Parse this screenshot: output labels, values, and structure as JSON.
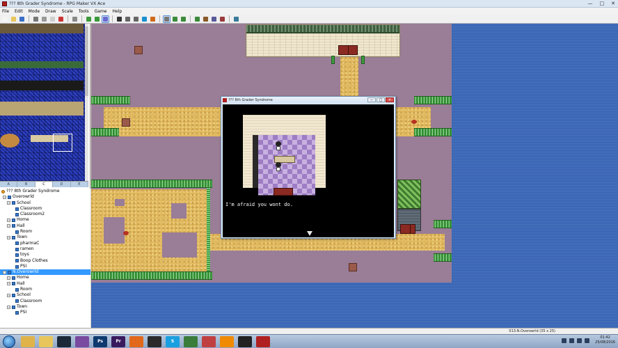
{
  "window": {
    "title": "??? 8th Grader Syndrome - RPG Maker VX Ace",
    "minimize": "—",
    "maximize": "□",
    "close": "✕"
  },
  "menu": [
    "File",
    "Edit",
    "Mode",
    "Draw",
    "Scale",
    "Tools",
    "Game",
    "Help"
  ],
  "toolbar": {
    "icons": [
      "new-icon",
      "open-icon",
      "save-icon",
      "sep",
      "cut-icon",
      "copy-icon",
      "paste-icon",
      "delete-icon",
      "sep",
      "undo-icon",
      "sep",
      "layer1-icon",
      "layer2-icon",
      "event-icon",
      "sep",
      "pencil-icon",
      "rect-icon",
      "ellipse-icon",
      "fill-icon",
      "shadow-icon",
      "sep",
      "zoom1-icon",
      "zoom2-icon",
      "zoom3-icon",
      "sep",
      "db-icon",
      "script-icon",
      "resource-icon",
      "sound-icon",
      "sep",
      "playtest-icon"
    ],
    "active": [
      "event-icon",
      "zoom1-icon"
    ]
  },
  "tileset_tabs": [
    "A",
    "B",
    "C",
    "D",
    "E"
  ],
  "tree": [
    {
      "label": "??? 8th Grader Syndrome",
      "level": 0,
      "kind": "project",
      "toggle": ""
    },
    {
      "label": "Overowrld",
      "level": 1,
      "kind": "map",
      "toggle": "−"
    },
    {
      "label": "School",
      "level": 2,
      "kind": "map",
      "toggle": "−"
    },
    {
      "label": "Classroom",
      "level": 3,
      "kind": "map",
      "toggle": ""
    },
    {
      "label": "Classroom2",
      "level": 3,
      "kind": "map",
      "toggle": ""
    },
    {
      "label": "Home",
      "level": 2,
      "kind": "map",
      "toggle": "−"
    },
    {
      "label": "Hall",
      "level": 2,
      "kind": "map",
      "toggle": "−"
    },
    {
      "label": "Room",
      "level": 3,
      "kind": "map",
      "toggle": ""
    },
    {
      "label": "Town",
      "level": 2,
      "kind": "map",
      "toggle": "−"
    },
    {
      "label": "pharmaC",
      "level": 3,
      "kind": "map",
      "toggle": ""
    },
    {
      "label": "ramen",
      "level": 3,
      "kind": "map",
      "toggle": ""
    },
    {
      "label": "toys",
      "level": 3,
      "kind": "map",
      "toggle": ""
    },
    {
      "label": "Boop Clothes",
      "level": 3,
      "kind": "map",
      "toggle": ""
    },
    {
      "label": "PSI",
      "level": 3,
      "kind": "map",
      "toggle": ""
    },
    {
      "label": "N.Overowrld",
      "level": 1,
      "kind": "map",
      "toggle": "−",
      "selected": true
    },
    {
      "label": "Home",
      "level": 2,
      "kind": "map",
      "toggle": "−"
    },
    {
      "label": "Hall",
      "level": 2,
      "kind": "map",
      "toggle": "−"
    },
    {
      "label": "Room",
      "level": 3,
      "kind": "map",
      "toggle": ""
    },
    {
      "label": "School",
      "level": 2,
      "kind": "map",
      "toggle": "−"
    },
    {
      "label": "Classroom",
      "level": 3,
      "kind": "map",
      "toggle": ""
    },
    {
      "label": "Town",
      "level": 2,
      "kind": "map",
      "toggle": "−"
    },
    {
      "label": "PSI",
      "level": 3,
      "kind": "map",
      "toggle": ""
    }
  ],
  "game_window": {
    "title": "??? 8th Grader Syndrome",
    "controls": [
      "−",
      "□",
      "✕"
    ],
    "message": "I'm afraid you wont do."
  },
  "status": "013:N.Overowrld (35 x 25)",
  "taskbar": {
    "apps": [
      {
        "name": "explorer-icon",
        "color": "#e0b34a",
        "label": ""
      },
      {
        "name": "folder-icon",
        "color": "#e8c65c",
        "label": ""
      },
      {
        "name": "steam-icon",
        "color": "#1b2838",
        "label": ""
      },
      {
        "name": "rar-icon",
        "color": "#7a4aa0",
        "label": ""
      },
      {
        "name": "photoshop-icon",
        "color": "#0f3a6e",
        "label": "Ps"
      },
      {
        "name": "premiere-icon",
        "color": "#3a1a5e",
        "label": "Pr"
      },
      {
        "name": "firefox-icon",
        "color": "#e2681b",
        "label": ""
      },
      {
        "name": "obs-icon",
        "color": "#2a2a2a",
        "label": ""
      },
      {
        "name": "skype-icon",
        "color": "#1aa0e0",
        "label": "S"
      },
      {
        "name": "rpgmaker-icon",
        "color": "#3a7d3a",
        "label": ""
      },
      {
        "name": "paint-icon",
        "color": "#c04040",
        "label": ""
      },
      {
        "name": "vlc-icon",
        "color": "#f08a00",
        "label": ""
      },
      {
        "name": "osu-icon",
        "color": "#222222",
        "label": ""
      },
      {
        "name": "game-icon",
        "color": "#b02020",
        "label": ""
      }
    ],
    "time": "01:42",
    "date": "25/08/2016"
  }
}
